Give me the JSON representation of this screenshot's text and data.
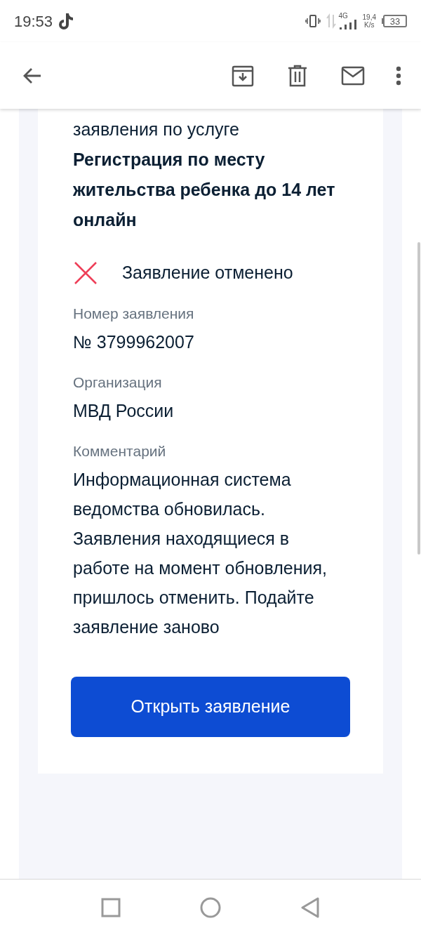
{
  "status_bar": {
    "time": "19:53",
    "speed_value": "19,4",
    "speed_unit": "K/s",
    "battery": "33",
    "network": "4G"
  },
  "service": {
    "intro": "заявления по услуге",
    "title": "Регистрация по месту жительства ребенка до 14 лет онлайн"
  },
  "status": {
    "kind": "cancelled",
    "text": "Заявление отменено"
  },
  "fields": [
    {
      "label": "Номер заявления",
      "value": "№ 3799962007"
    },
    {
      "label": "Организация",
      "value": "МВД России"
    },
    {
      "label": "Комментарий",
      "value": "Информационная система ведомства обновилась. Заявления находящиеся в работе на момент обновления, пришлось отменить. Подайте заявление заново"
    }
  ],
  "button": {
    "label": "Открыть заявление"
  }
}
